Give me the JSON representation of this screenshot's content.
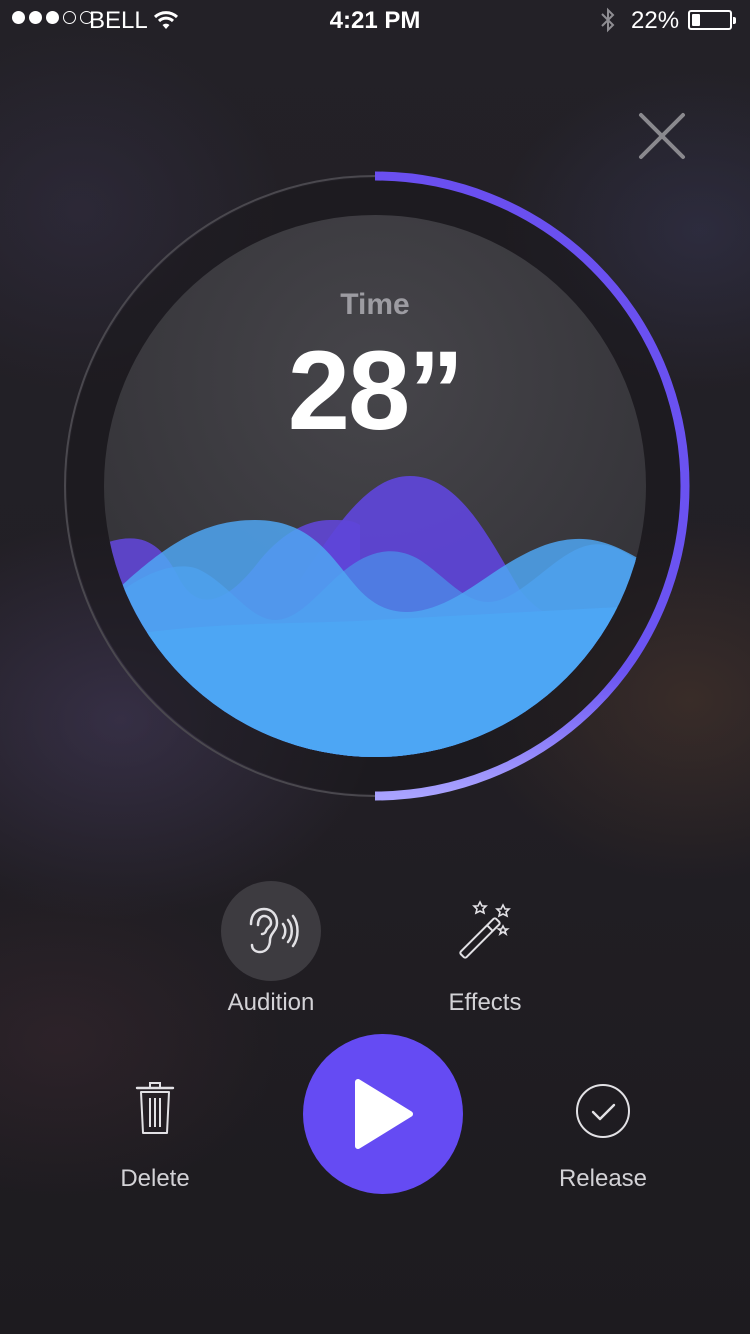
{
  "status_bar": {
    "carrier": "BELL",
    "time": "4:21 PM",
    "battery_percent": "22%",
    "battery_level": 0.22,
    "signal_bars": 3,
    "signal_total": 5
  },
  "recording": {
    "time_label": "Time",
    "time_value": "28”",
    "progress": 0.5
  },
  "actions": {
    "audition_label": "Audition",
    "effects_label": "Effects",
    "delete_label": "Delete",
    "release_label": "Release"
  },
  "icons": {
    "close": "close-icon",
    "audition": "ear-icon",
    "effects": "magic-wand-icon",
    "delete": "trash-icon",
    "play": "play-icon",
    "release": "check-circle-icon"
  },
  "colors": {
    "accent": "#654bf3",
    "ring": "#6a4ff0",
    "wave_blue": "#4fa6f2",
    "wave_purple": "#6549e0",
    "background": "#1f1d22"
  }
}
